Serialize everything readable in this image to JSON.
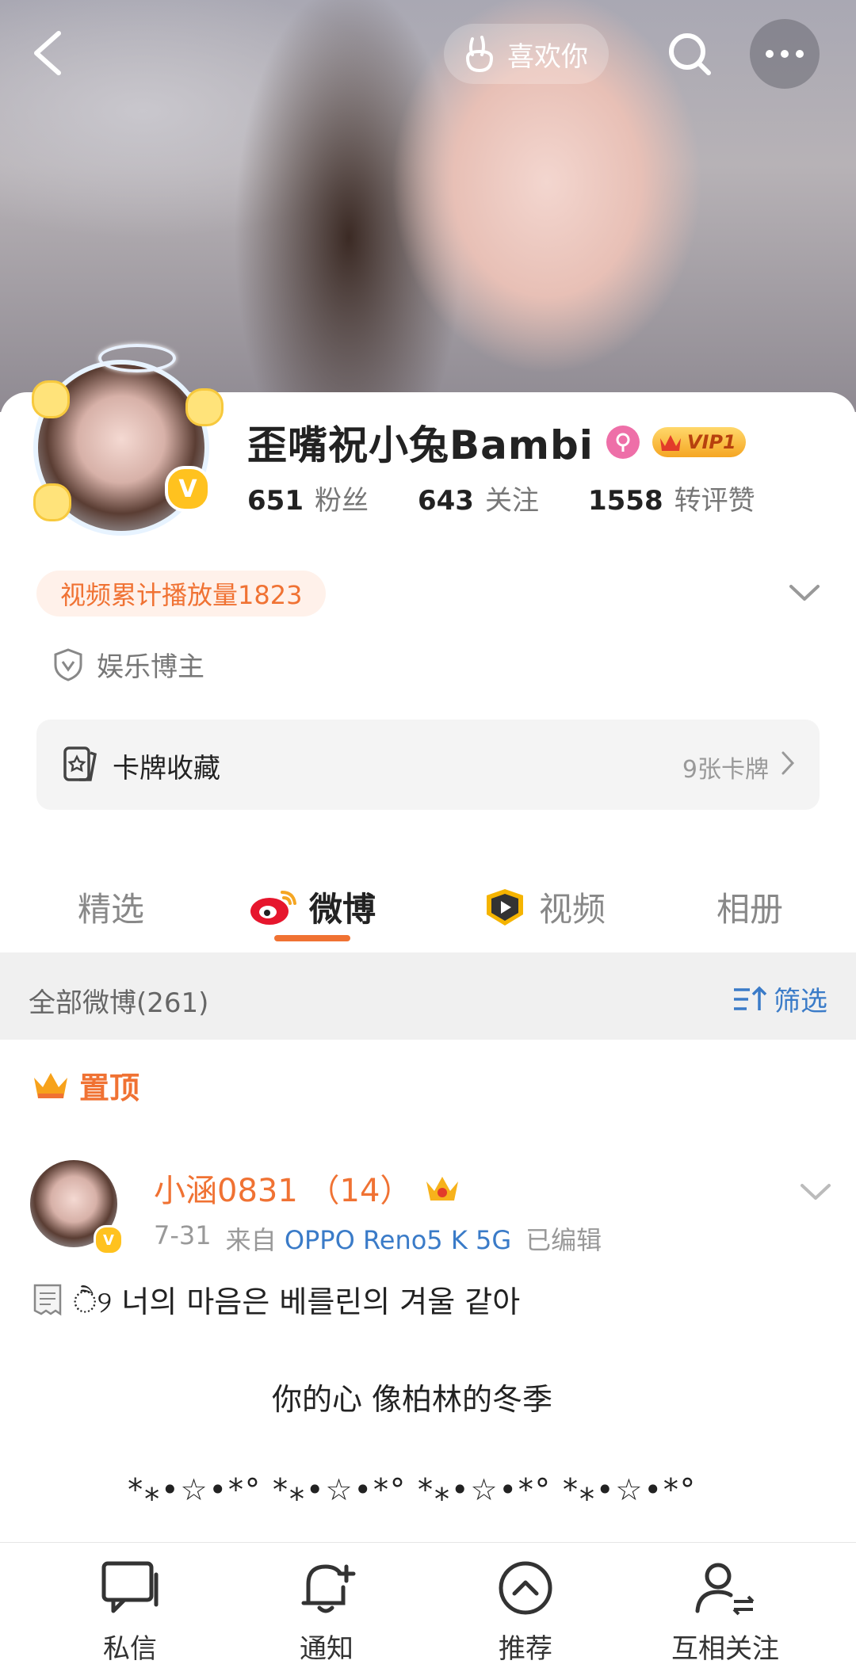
{
  "header": {
    "like_label": "喜欢你"
  },
  "profile": {
    "name": "歪嘴祝小兔Bambi",
    "vip_label": "VIP1",
    "stats": [
      {
        "value": "651",
        "label": "粉丝"
      },
      {
        "value": "643",
        "label": "关注"
      },
      {
        "value": "1558",
        "label": "转评赞"
      }
    ],
    "play_count_label": "视频累计播放量1823",
    "role": "娱乐博主",
    "card_collection": {
      "title": "卡牌收藏",
      "count": "9张卡牌"
    }
  },
  "tabs": [
    {
      "label": "精选",
      "active": false
    },
    {
      "label": "微博",
      "active": true
    },
    {
      "label": "视频",
      "active": false
    },
    {
      "label": "相册",
      "active": false
    }
  ],
  "feed": {
    "all_label": "全部微博(261)",
    "filter_label": "筛选",
    "pinned_label": "置顶"
  },
  "post": {
    "author": "小涵0831 （14）",
    "date": "7-31",
    "source_prefix": "来自",
    "source": "OPPO Reno5 K 5G",
    "edited": "已编辑",
    "line1": "ੈ୨ 너의 마음은 베를린의 겨울 같아",
    "line2": "你的心 像柏林的冬季",
    "line3": "*⁎•☆•*° *⁎•☆•*° *⁎•☆•*° *⁎•☆•*°"
  },
  "bottom_nav": [
    {
      "label": "私信",
      "icon": "message-icon"
    },
    {
      "label": "通知",
      "icon": "bell-add-icon"
    },
    {
      "label": "推荐",
      "icon": "recommend-icon"
    },
    {
      "label": "互相关注",
      "icon": "mutual-follow-icon"
    }
  ],
  "colors": {
    "accent": "#f07233",
    "link": "#3a7bc8",
    "vip": "#f5a623",
    "gender": "#ee6fa8"
  }
}
